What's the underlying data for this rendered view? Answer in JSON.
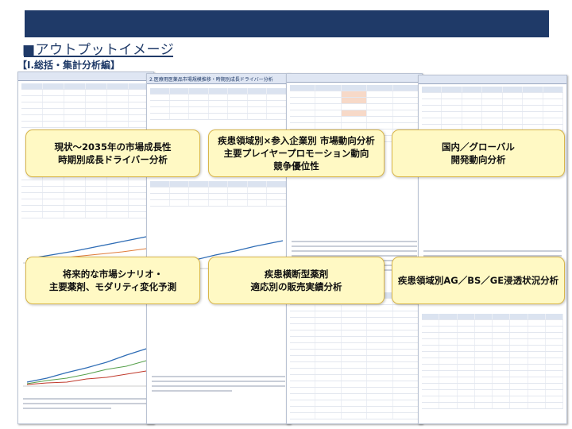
{
  "header": {
    "title": "■アウトプットイメージ",
    "section": "【Ⅰ.総括・集計分析編】"
  },
  "callouts": [
    {
      "text": "現状～2035年の市場成長性\n時期別成長ドライバー分析"
    },
    {
      "text": "疾患領域別×参入企業別 市場動向分析\n主要プレイヤープロモーション動向\n競争優位性"
    },
    {
      "text": "国内／グローバル\n開発動向分析"
    },
    {
      "text": "将来的な市場シナリオ・\n主要薬剤、モダリティ変化予測"
    },
    {
      "text": "疾患横断型薬剤\n適応別の販売実績分析"
    },
    {
      "text": "疾患領域別AG／BS／GE浸透状況分析"
    }
  ],
  "documents": {
    "doc2_title": "2.医療用医薬品市場規模推移・時期別成長ドライバー分析"
  },
  "colors": {
    "topbar": "#1f3a68",
    "callout_bg": "#fff9c4",
    "callout_border": "#d9b64a"
  }
}
